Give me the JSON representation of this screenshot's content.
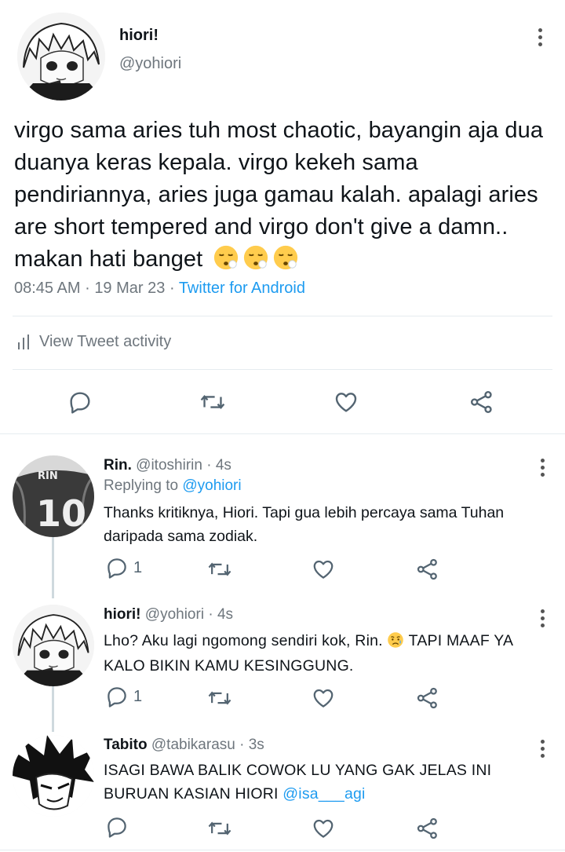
{
  "main_tweet": {
    "display_name": "hiori!",
    "handle": "@yohiori",
    "text": "virgo sama aries tuh most chaotic, bayangin aja dua duanya keras kepala. virgo kekeh sama pendiriannya, aries juga gamau kalah. apalagi aries are short tempered and virgo don't give a damn.. makan hati banget",
    "emoji": "😮‍💨😮‍💨😮‍💨",
    "time": "08:45 AM",
    "date": "19 Mar 23",
    "source": "Twitter for Android",
    "separator": "·",
    "activity_label": "View Tweet activity"
  },
  "replies": [
    {
      "display_name": "Rin.",
      "handle": "@itoshirin",
      "age": "4s",
      "replying_to_label": "Replying to",
      "replying_to": "@yohiori",
      "text": "Thanks kritiknya, Hiori. Tapi gua lebih percaya sama Tuhan daripada sama zodiak.",
      "reply_count": "1"
    },
    {
      "display_name": "hiori!",
      "handle": "@yohiori",
      "age": "4s",
      "text": "Lho? Aku lagi ngomong sendiri kok, Rin.",
      "emoji": "😥",
      "text2": "TAPI MAAF YA KALO BIKIN KAMU KESINGGUNG.",
      "reply_count": "1"
    },
    {
      "display_name": "Tabito",
      "handle": "@tabikarasu",
      "age": "3s",
      "text": "ISAGI BAWA BALIK COWOK LU YANG GAK JELAS INI BURUAN KASIAN HIORI",
      "mention": "@isa___agi"
    }
  ],
  "icons": [
    "more-vertical-icon",
    "reply-icon",
    "retweet-icon",
    "like-icon",
    "share-icon",
    "activity-bars-icon"
  ],
  "colors": {
    "link": "#1d9bf0",
    "muted": "#6e767d",
    "divider": "#e6ecf0",
    "text": "#0f1419"
  }
}
